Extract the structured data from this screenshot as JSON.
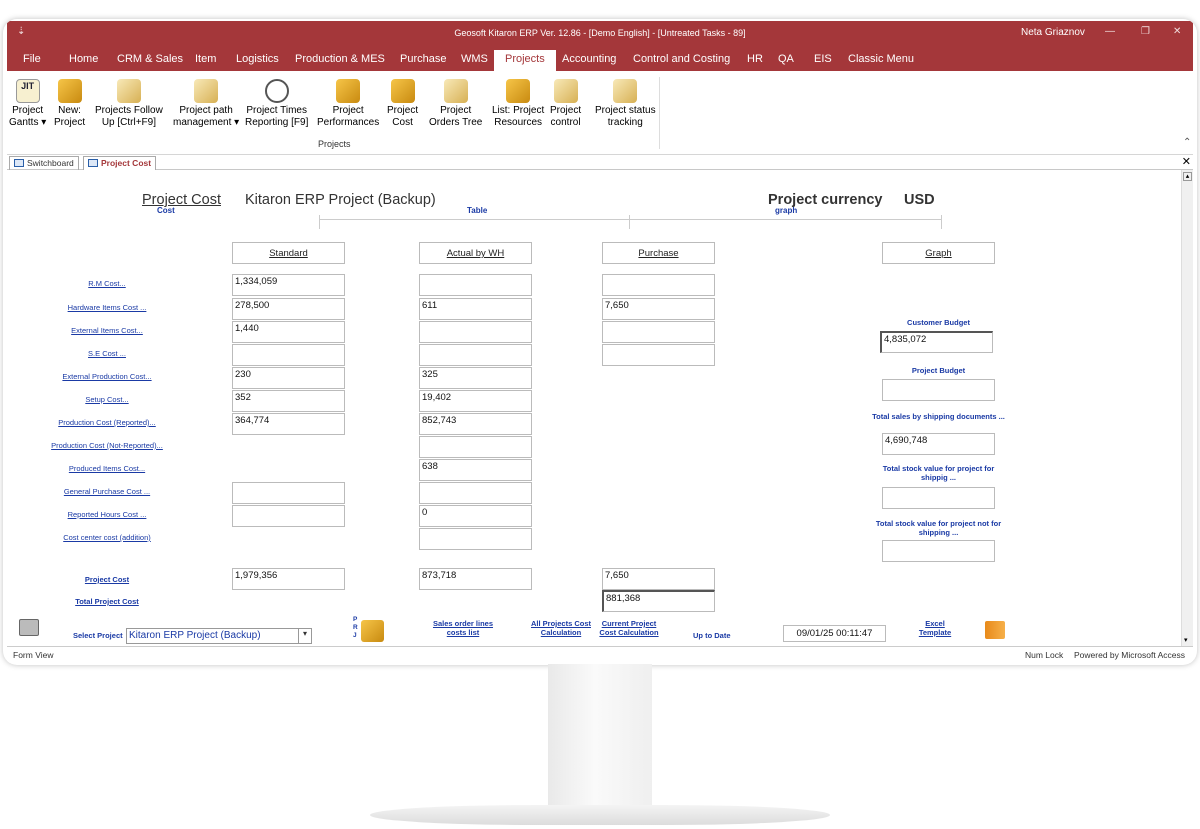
{
  "window": {
    "title": "Geosoft Kitaron ERP Ver. 12.86 - [Demo English] - [Untreated Tasks - 89]",
    "user": "Neta Griaznov",
    "accent": "#a4373a"
  },
  "menu_tabs": [
    "File",
    "Home",
    "CRM & Sales",
    "Item",
    "Logistics",
    "Production & MES",
    "Purchase",
    "WMS",
    "Projects",
    "Accounting",
    "Control and Costing",
    "HR",
    "QA",
    "EIS",
    "Classic Menu"
  ],
  "active_menu_tab": "Projects",
  "ribbon": {
    "buttons": [
      {
        "line1": "Project",
        "line2": "Gantts ▾",
        "icon": "jit-icon"
      },
      {
        "line1": "New:",
        "line2": "Project",
        "icon": "new-project-icon"
      },
      {
        "line1": "Projects Follow",
        "line2": "Up [Ctrl+F9]",
        "icon": "follow-up-icon"
      },
      {
        "line1": "Project path",
        "line2": "management ▾",
        "icon": "path-icon"
      },
      {
        "line1": "Project Times",
        "line2": "Reporting [F9]",
        "icon": "clock-icon"
      },
      {
        "line1": "Project",
        "line2": "Performances",
        "icon": "performance-icon"
      },
      {
        "line1": "Project",
        "line2": "Cost",
        "icon": "cost-icon"
      },
      {
        "line1": "Project",
        "line2": "Orders Tree",
        "icon": "tree-icon"
      },
      {
        "line1": "List: Project",
        "line2": "Resources",
        "icon": "resources-icon"
      },
      {
        "line1": "Project",
        "line2": "control",
        "icon": "control-icon"
      },
      {
        "line1": "Project status",
        "line2": "tracking",
        "icon": "status-icon"
      }
    ],
    "group_label": "Projects"
  },
  "doc_tabs": [
    "Switchboard",
    "Project Cost"
  ],
  "active_doc_tab": "Project Cost",
  "form": {
    "title_link": "Project Cost",
    "project_name": "Kitaron ERP Project (Backup)",
    "currency_label": "Project currency",
    "currency": "USD",
    "sub_tabs": [
      "Cost",
      "Table",
      "graph"
    ],
    "columns": [
      "Standard",
      "Actual by WH",
      "Purchase",
      "Graph"
    ],
    "rows": [
      {
        "label": "R.M Cost...",
        "standard": "1,334,059",
        "actual": "",
        "purchase": ""
      },
      {
        "label": "Hardware Items Cost ...",
        "standard": "278,500",
        "actual": "611",
        "purchase": "7,650"
      },
      {
        "label": "External Items Cost...",
        "standard": "1,440",
        "actual": "",
        "purchase": ""
      },
      {
        "label": "S.E Cost ...",
        "standard": "",
        "actual": "",
        "purchase": ""
      },
      {
        "label": "External Production Cost...",
        "standard": "230",
        "actual": "325"
      },
      {
        "label": "Setup Cost...",
        "standard": "352",
        "actual": "19,402"
      },
      {
        "label": "Production Cost (Reported)...",
        "standard": "364,774",
        "actual": "852,743"
      },
      {
        "label": "Production Cost (Not-Reported)...",
        "actual": ""
      },
      {
        "label": "Produced Items Cost...",
        "actual": "638"
      },
      {
        "label": "General Purchase Cost ...",
        "standard": "",
        "actual": ""
      },
      {
        "label": "Reported Hours Cost ...",
        "standard": "",
        "actual": "0"
      },
      {
        "label": "Cost center cost (addition)",
        "actual": ""
      }
    ],
    "project_cost_label": "Project Cost",
    "project_cost": {
      "standard": "1,979,356",
      "actual": "873,718",
      "purchase": "7,650"
    },
    "total_project_cost_label": "Total Project Cost",
    "total_project_cost": "881,368",
    "graph_panel": {
      "customer_budget_label": "Customer Budget",
      "customer_budget": "4,835,072",
      "project_budget_label": "Project Budget",
      "project_budget": "",
      "total_sales_label": "Total sales by shipping documents ...",
      "total_sales": "4,690,748",
      "stock_for_shipping_label": "Total stock value for project for shippig ...",
      "stock_for_shipping": "",
      "stock_not_for_shipping_label": "Total stock value for project not for shipping ...",
      "stock_not_for_shipping": ""
    },
    "bottom": {
      "select_project_label": "Select Project",
      "select_project_value": "Kitaron ERP Project (Backup)",
      "prj_letters": "P R J",
      "sales_order_lines": "Sales order lines costs list",
      "all_projects": "All Projects Cost Calculation",
      "current_project": "Current Project Cost Calculation",
      "up_to_date_label": "Up to Date",
      "up_to_date": "09/01/25 00:11:47",
      "excel_template": "Excel Template"
    }
  },
  "status": {
    "left": "Form View",
    "num_lock": "Num Lock",
    "powered": "Powered by Microsoft Access"
  }
}
